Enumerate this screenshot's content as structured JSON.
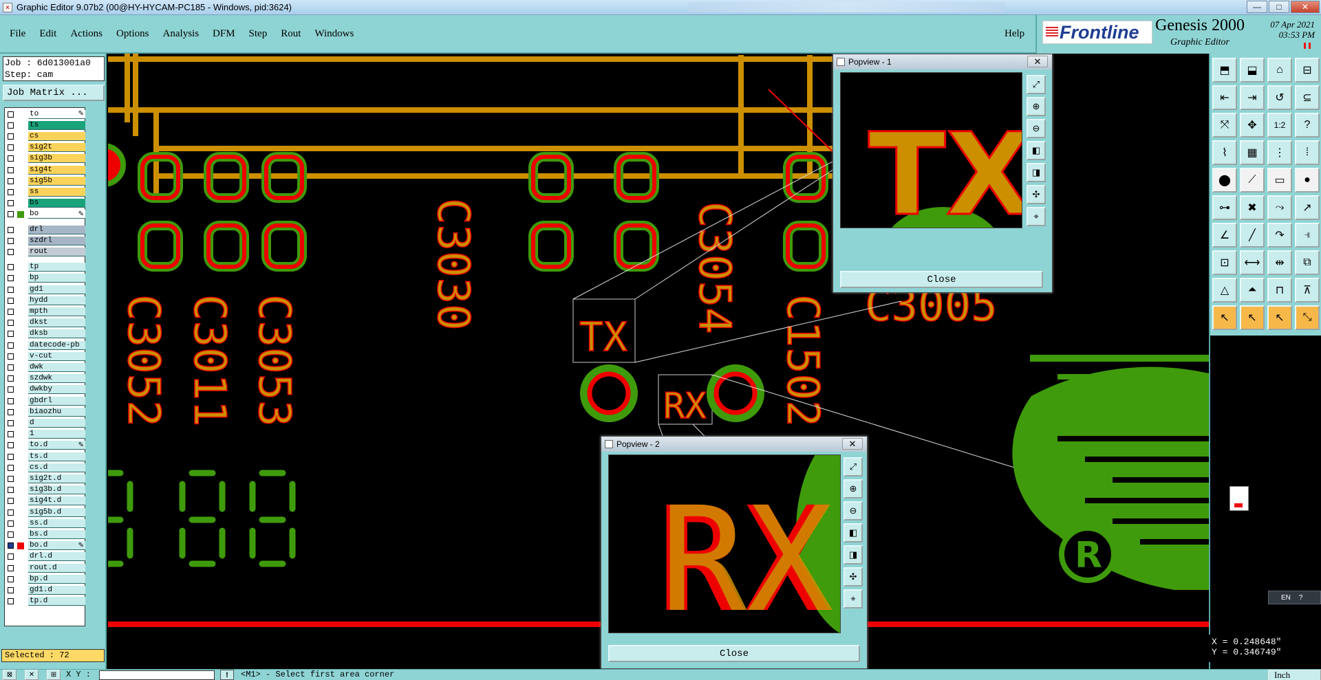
{
  "window": {
    "title": "Graphic Editor 9.07b2 (00@HY-HYCAM-PC185 - Windows, pid:3624)",
    "buttons": {
      "minimize": "—",
      "maximize": "□",
      "close": "✕"
    }
  },
  "menu": {
    "items": [
      "File",
      "Edit",
      "Actions",
      "Options",
      "Analysis",
      "DFM",
      "Step",
      "Rout",
      "Windows"
    ],
    "help": "Help"
  },
  "brand": {
    "logo": "Frontline",
    "product": "Genesis 2000",
    "subtitle": "Graphic Editor",
    "date": "07 Apr 2021",
    "time": "03:53 PM"
  },
  "job": {
    "job_line": "Job : 6d013001a0",
    "step_line": "Step: cam",
    "matrix_button": "Job Matrix ..."
  },
  "colors": {
    "panel": "#8fd4d4",
    "layer_orange": "#fbd35a",
    "layer_teal": "#1aa37a",
    "layer_grey": "#a6b6c6",
    "layer_lightblue": "#c9ecec",
    "pad_red": "#ff0000",
    "feature_orange": "#cc8f00",
    "feature_green": "#3f9b0b"
  },
  "layers": [
    {
      "name": "to",
      "bg": "white",
      "flag": "✎"
    },
    {
      "name": "ts",
      "bg": "teal",
      "flag": ""
    },
    {
      "name": "cs",
      "bg": "orange",
      "flag": ""
    },
    {
      "name": "sig2t",
      "bg": "orange",
      "flag": ""
    },
    {
      "name": "sig3b",
      "bg": "orange",
      "flag": ""
    },
    {
      "name": "sig4t",
      "bg": "orange",
      "flag": ""
    },
    {
      "name": "sig5b",
      "bg": "orange",
      "flag": ""
    },
    {
      "name": "ss",
      "bg": "orange",
      "flag": ""
    },
    {
      "name": "bs",
      "bg": "teal",
      "flag": ""
    },
    {
      "name": "bo",
      "bg": "white",
      "flag": "✎",
      "color": "#3f9b0b"
    },
    {
      "name": "drl",
      "bg": "grey",
      "flag": ""
    },
    {
      "name": "szdrl",
      "bg": "grey",
      "flag": ""
    },
    {
      "name": "rout",
      "bg": "grey2",
      "flag": ""
    },
    {
      "name": "tp",
      "bg": "light",
      "flag": ""
    },
    {
      "name": "bp",
      "bg": "light",
      "flag": ""
    },
    {
      "name": "gd1",
      "bg": "light",
      "flag": ""
    },
    {
      "name": "hydd",
      "bg": "light",
      "flag": ""
    },
    {
      "name": "mpth",
      "bg": "light",
      "flag": ""
    },
    {
      "name": "dkst",
      "bg": "light",
      "flag": ""
    },
    {
      "name": "dksb",
      "bg": "light",
      "flag": ""
    },
    {
      "name": "datecode-pb",
      "bg": "light",
      "flag": ""
    },
    {
      "name": "v-cut",
      "bg": "light",
      "flag": ""
    },
    {
      "name": "dwk",
      "bg": "light",
      "flag": ""
    },
    {
      "name": "szdwk",
      "bg": "light",
      "flag": ""
    },
    {
      "name": "dwkby",
      "bg": "light",
      "flag": ""
    },
    {
      "name": "gbdrl",
      "bg": "light",
      "flag": ""
    },
    {
      "name": "biaozhu",
      "bg": "light",
      "flag": ""
    },
    {
      "name": "d",
      "bg": "light",
      "flag": ""
    },
    {
      "name": "1",
      "bg": "light",
      "flag": ""
    },
    {
      "name": "to.d",
      "bg": "light",
      "flag": "✎"
    },
    {
      "name": "ts.d",
      "bg": "light",
      "flag": ""
    },
    {
      "name": "cs.d",
      "bg": "light",
      "flag": ""
    },
    {
      "name": "sig2t.d",
      "bg": "light",
      "flag": ""
    },
    {
      "name": "sig3b.d",
      "bg": "light",
      "flag": ""
    },
    {
      "name": "sig4t.d",
      "bg": "light",
      "flag": ""
    },
    {
      "name": "sig5b.d",
      "bg": "light",
      "flag": ""
    },
    {
      "name": "ss.d",
      "bg": "light",
      "flag": ""
    },
    {
      "name": "bs.d",
      "bg": "light",
      "flag": ""
    },
    {
      "name": "bo.d",
      "bg": "light",
      "flag": "✎",
      "active": true
    },
    {
      "name": "drl.d",
      "bg": "light",
      "flag": ""
    },
    {
      "name": "rout.d",
      "bg": "light",
      "flag": ""
    },
    {
      "name": "bp.d",
      "bg": "light",
      "flag": ""
    },
    {
      "name": "gd1.d",
      "bg": "light",
      "flag": ""
    },
    {
      "name": "tp.d",
      "bg": "light",
      "flag": ""
    }
  ],
  "selected": "Selected : 72",
  "canvas": {
    "refdes": [
      "C3052",
      "C3011",
      "C3053",
      "C3030",
      "C3054",
      "C1502",
      "C3005"
    ],
    "label_tx": "TX",
    "label_rx": "RX"
  },
  "popview1": {
    "title": "Popview - 1",
    "close": "Close",
    "text": "TX"
  },
  "popview2": {
    "title": "Popview - 2",
    "close": "Close",
    "text": "RX"
  },
  "coords": {
    "x": "X = 0.248648\"",
    "y": "Y = 0.346749\""
  },
  "ime": "EN",
  "status": {
    "xy_label": "X Y :",
    "message": "<M1> - Select first area corner",
    "units": "Inch"
  }
}
